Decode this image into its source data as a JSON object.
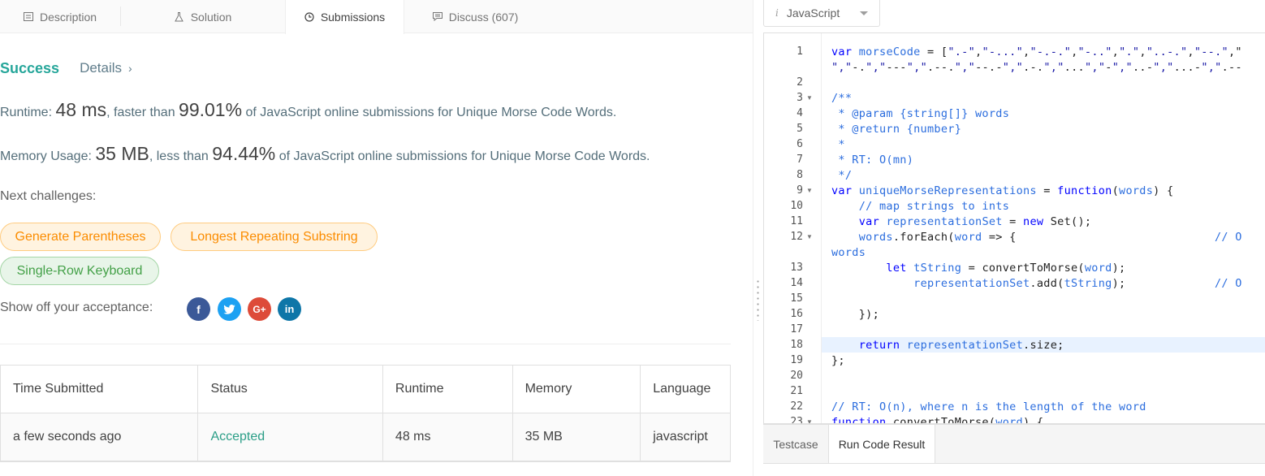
{
  "tabs": [
    {
      "label": "Description",
      "icon": "description-icon"
    },
    {
      "label": "Solution",
      "icon": "flask-icon"
    },
    {
      "label": "Submissions",
      "icon": "clock-icon"
    },
    {
      "label": "Discuss (607)",
      "icon": "chat-icon"
    }
  ],
  "result": {
    "status": "Success",
    "details": "Details",
    "runtime_label": "Runtime: ",
    "runtime_value": "48 ms",
    "runtime_mid": ", faster than ",
    "runtime_pct": "99.01%",
    "runtime_tail": " of JavaScript online submissions for Unique Morse Code Words.",
    "memory_label": "Memory Usage: ",
    "memory_value": "35 MB",
    "memory_mid": ", less than ",
    "memory_pct": "94.44%",
    "memory_tail": " of JavaScript online submissions for Unique Morse Code Words."
  },
  "challenges": {
    "label": "Next challenges:",
    "items": [
      {
        "label": "Generate Parentheses",
        "difficulty": "medium"
      },
      {
        "label": "Longest Repeating Substring",
        "difficulty": "medium"
      },
      {
        "label": "Single-Row Keyboard",
        "difficulty": "easy"
      }
    ]
  },
  "share": {
    "label": "Show off your acceptance:",
    "icons": [
      {
        "name": "facebook-icon",
        "glyph": "f",
        "color": "#3b5998"
      },
      {
        "name": "twitter-icon",
        "glyph": "t",
        "color": "#1da1f2"
      },
      {
        "name": "google-plus-icon",
        "glyph": "G+",
        "color": "#dd4b39"
      },
      {
        "name": "linkedin-icon",
        "glyph": "in",
        "color": "#0e76a8"
      }
    ]
  },
  "table": {
    "headers": [
      "Time Submitted",
      "Status",
      "Runtime",
      "Memory",
      "Language"
    ],
    "rows": [
      [
        "a few seconds ago",
        "Accepted",
        "48 ms",
        "35 MB",
        "javascript"
      ]
    ]
  },
  "editor": {
    "language": "JavaScript",
    "info_glyph": "i",
    "bottom_tabs": [
      "Testcase",
      "Run Code Result"
    ],
    "line_numbers": [
      "1",
      "",
      "2",
      "3",
      "4",
      "5",
      "6",
      "7",
      "8",
      "9",
      "10",
      "11",
      "12",
      "",
      "13",
      "14",
      "15",
      "16",
      "17",
      "18",
      "19",
      "20",
      "21",
      "22",
      "23"
    ],
    "lines": [
      "var morseCode = [\".-\",\"-...\",\"-.-.\",\"-..\",\".\",\"..-.\",\"--.\",\"",
      "\",\"-.\",\"---\",\".--.\",\"--.-\",\".-.\",\"...\",\"-\",\"..-\",\"...-\",\".--",
      "",
      "/**",
      " * @param {string[]} words",
      " * @return {number}",
      " *",
      " * RT: O(mn)",
      " */",
      "var uniqueMorseRepresentations = function(words) {",
      "    // map strings to ints",
      "    var representationSet = new Set();",
      "    words.forEach(word => {                             // O",
      "words",
      "        let tString = convertToMorse(word);",
      "            representationSet.add(tString);             // O",
      "",
      "    });",
      "",
      "    return representationSet.size;",
      "};",
      "",
      "",
      "// RT: O(n), where n is the length of the word",
      "function convertToMorse(word) {"
    ]
  }
}
